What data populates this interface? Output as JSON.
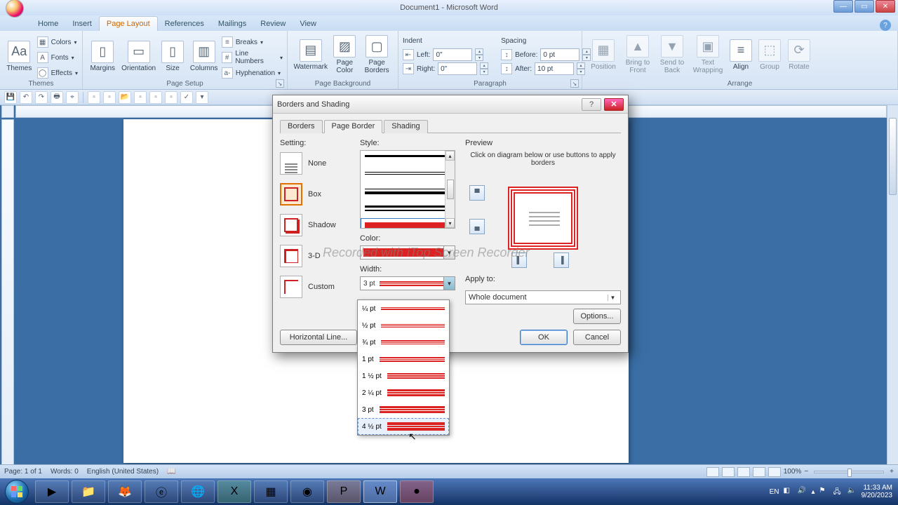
{
  "app": {
    "title": "Document1 - Microsoft Word"
  },
  "tabs": {
    "home": "Home",
    "insert": "Insert",
    "page_layout": "Page Layout",
    "references": "References",
    "mailings": "Mailings",
    "review": "Review",
    "view": "View"
  },
  "ribbon": {
    "themes": {
      "label": "Themes",
      "colors": "Colors",
      "fonts": "Fonts",
      "effects": "Effects",
      "group": "Themes"
    },
    "setup": {
      "margins": "Margins",
      "orientation": "Orientation",
      "size": "Size",
      "columns": "Columns",
      "breaks": "Breaks",
      "line_numbers": "Line Numbers",
      "hyphenation": "Hyphenation",
      "group": "Page Setup"
    },
    "background": {
      "watermark": "Watermark",
      "page_color": "Page Color",
      "page_borders": "Page Borders",
      "group": "Page Background"
    },
    "paragraph": {
      "indent": "Indent",
      "left": "Left:",
      "right": "Right:",
      "left_v": "0\"",
      "right_v": "0\"",
      "spacing": "Spacing",
      "before": "Before:",
      "after": "After:",
      "before_v": "0 pt",
      "after_v": "10 pt",
      "group": "Paragraph"
    },
    "arrange": {
      "position": "Position",
      "bring_front": "Bring to Front",
      "send_back": "Send to Back",
      "text_wrap": "Text Wrapping",
      "align": "Align",
      "group_btn": "Group",
      "rotate": "Rotate",
      "group": "Arrange"
    }
  },
  "status": {
    "page": "Page: 1 of 1",
    "words": "Words: 0",
    "lang": "English (United States)",
    "zoom": "100%"
  },
  "taskbar": {
    "lang": "EN",
    "time": "11:33 AM",
    "date": "9/20/2023"
  },
  "dialog": {
    "title": "Borders and Shading",
    "tabs": {
      "borders": "Borders",
      "page_border": "Page Border",
      "shading": "Shading"
    },
    "setting_label": "Setting:",
    "settings": {
      "none": "None",
      "box": "Box",
      "shadow": "Shadow",
      "threed": "3-D",
      "custom": "Custom"
    },
    "style_label": "Style:",
    "color_label": "Color:",
    "width_label": "Width:",
    "width_value": "3 pt",
    "preview_label": "Preview",
    "preview_hint": "Click on diagram below or use buttons to apply borders",
    "apply_label": "Apply to:",
    "apply_value": "Whole document",
    "options": "Options...",
    "hline": "Horizontal Line...",
    "ok": "OK",
    "cancel": "Cancel",
    "widths": [
      "¼ pt",
      "½ pt",
      "¾ pt",
      "1 pt",
      "1 ½ pt",
      "2 ¼ pt",
      "3 pt",
      "4 ½ pt"
    ]
  },
  "watermark": "Recorded with iTop Screen Recorder"
}
